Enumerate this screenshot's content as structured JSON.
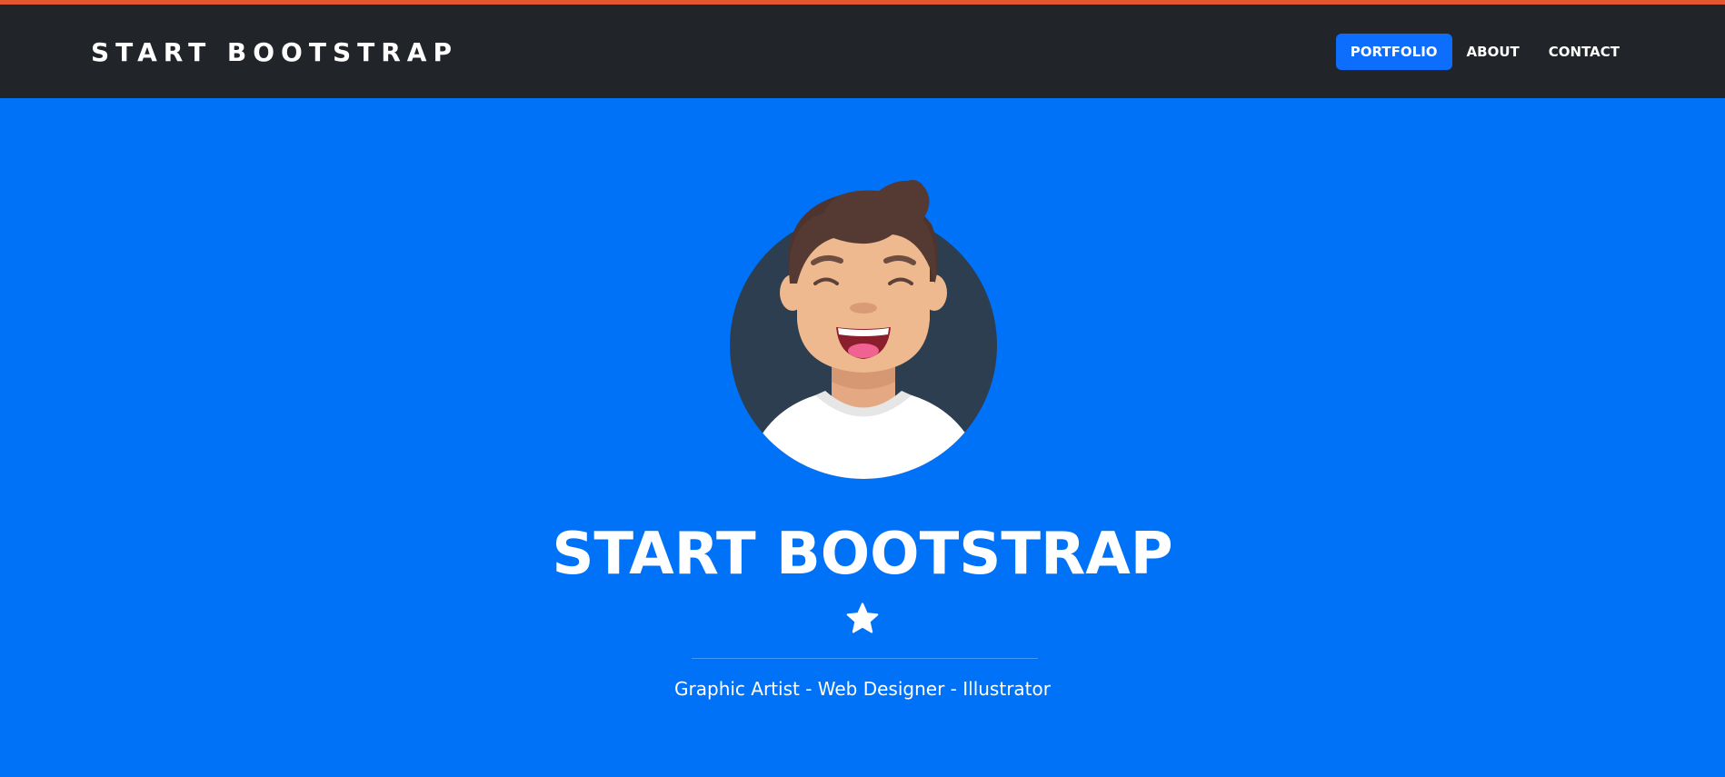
{
  "brand": {
    "title": "START BOOTSTRAP"
  },
  "nav": {
    "items": [
      {
        "label": "PORTFOLIO",
        "active": true
      },
      {
        "label": "ABOUT",
        "active": false
      },
      {
        "label": "CONTACT",
        "active": false
      }
    ]
  },
  "masthead": {
    "avatar": "avatar-illustration",
    "title": "START BOOTSTRAP",
    "divider_icon": "star-icon",
    "subtitle": "Graphic Artist - Web Designer - Illustrator"
  },
  "colors": {
    "accent_bar": "#e4572e",
    "navbar_bg": "#212529",
    "page_bg": "#0072f7",
    "active_nav_bg": "#0d6efd",
    "text": "#ffffff"
  }
}
